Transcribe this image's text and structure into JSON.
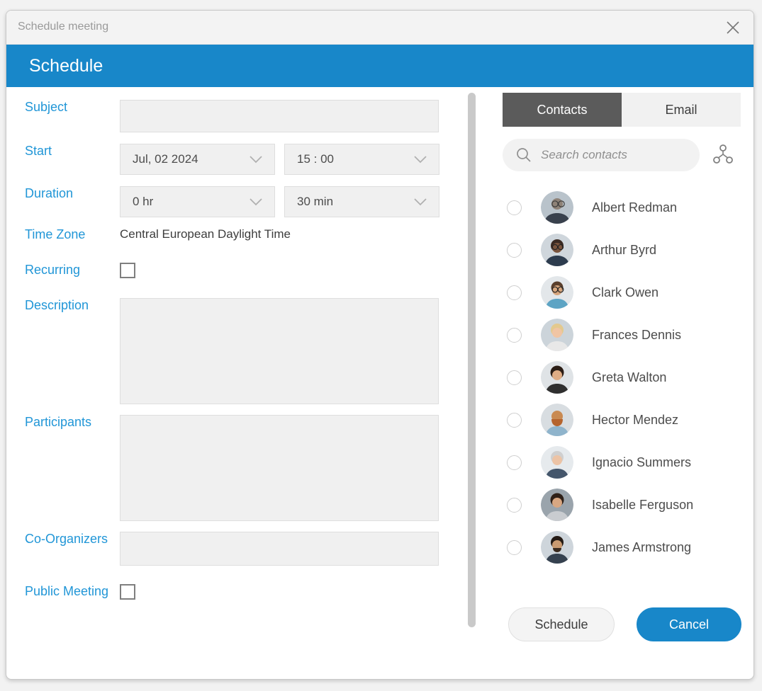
{
  "window": {
    "title": "Schedule meeting",
    "close_icon": "close-icon"
  },
  "header": {
    "title": "Schedule",
    "accent_color": "#1887c9"
  },
  "form": {
    "label_color": "#2196d7",
    "fields": {
      "subject": {
        "label": "Subject",
        "value": ""
      },
      "start": {
        "label": "Start",
        "date_value": "Jul, 02 2024",
        "time_value": "15 :  00"
      },
      "duration": {
        "label": "Duration",
        "hours_value": "0   hr",
        "minutes_value": "30   min"
      },
      "timezone": {
        "label": "Time Zone",
        "value": "Central European Daylight Time"
      },
      "recurring": {
        "label": "Recurring",
        "checked": false
      },
      "description": {
        "label": "Description",
        "value": ""
      },
      "participants": {
        "label": "Participants",
        "value": ""
      },
      "coorganizers": {
        "label": "Co-Organizers",
        "value": ""
      },
      "public_meeting": {
        "label": "Public Meeting",
        "checked": false
      }
    }
  },
  "panel": {
    "tabs": [
      {
        "label": "Contacts",
        "active": true
      },
      {
        "label": "Email",
        "active": false
      }
    ],
    "search": {
      "placeholder": "Search contacts",
      "value": "",
      "icon": "search-icon"
    },
    "share_icon": "share-nodes-icon",
    "contacts": [
      {
        "name": "Albert Redman",
        "selected": false
      },
      {
        "name": "Arthur Byrd",
        "selected": false
      },
      {
        "name": "Clark Owen",
        "selected": false
      },
      {
        "name": "Frances Dennis",
        "selected": false
      },
      {
        "name": "Greta Walton",
        "selected": false
      },
      {
        "name": "Hector Mendez",
        "selected": false
      },
      {
        "name": "Ignacio Summers",
        "selected": false
      },
      {
        "name": "Isabelle Ferguson",
        "selected": false
      },
      {
        "name": "James Armstrong",
        "selected": false
      }
    ],
    "buttons": {
      "schedule": "Schedule",
      "cancel": "Cancel"
    }
  }
}
